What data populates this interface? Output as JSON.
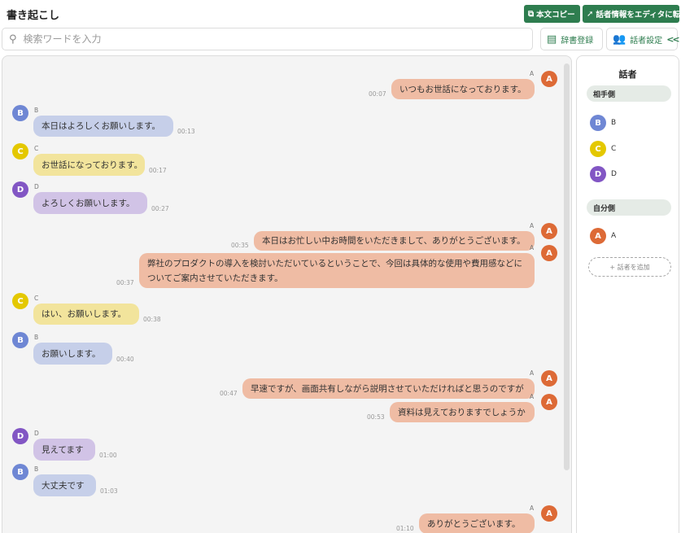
{
  "app": {
    "title": "書き起こし"
  },
  "toolbar": {
    "copy_label": "本文コピー",
    "reflect_label": "話者情報をエディタに転記",
    "search_placeholder": "検索ワードを入力",
    "dict_label": "辞書登録",
    "speaker_settings_label": "話者設定",
    "collapse_label": "<<"
  },
  "messages": [
    {
      "speaker": "A",
      "text": "いつもお世話になっております。",
      "time": "00:07"
    },
    {
      "speaker": "B",
      "text": "本日はよろしくお願いします。",
      "time": "00:13"
    },
    {
      "speaker": "C",
      "text": "お世話になっております。",
      "time": "00:17"
    },
    {
      "speaker": "D",
      "text": "よろしくお願いします。",
      "time": "00:27"
    },
    {
      "speaker": "A",
      "text": "本日はお忙しい中お時間をいただきまして、ありがとうございます。",
      "time": "00:35"
    },
    {
      "speaker": "A",
      "text": "弊社のプロダクトの導入を検討いただいているということで、今回は具体的な使用や費用感などについてご案内させていただきます。",
      "time": "00:37"
    },
    {
      "speaker": "C",
      "text": "はい、お願いします。",
      "time": "00:38"
    },
    {
      "speaker": "B",
      "text": "お願いします。",
      "time": "00:40"
    },
    {
      "speaker": "A",
      "text": "早速ですが、画面共有しながら説明させていただければと思うのですが",
      "time": "00:47"
    },
    {
      "speaker": "A",
      "text": "資料は見えておりますでしょうか",
      "time": "00:53"
    },
    {
      "speaker": "D",
      "text": "見えてます",
      "time": "01:00"
    },
    {
      "speaker": "B",
      "text": "大丈夫です",
      "time": "01:03"
    },
    {
      "speaker": "A",
      "text": "ありがとうございます。",
      "time": "01:10"
    }
  ],
  "panel": {
    "title": "話者",
    "group_other": "相手側",
    "group_self": "自分側",
    "others": [
      {
        "letter": "B",
        "name": "B"
      },
      {
        "letter": "C",
        "name": "C"
      },
      {
        "letter": "D",
        "name": "D"
      }
    ],
    "self": [
      {
        "letter": "A",
        "name": "A"
      }
    ],
    "add_label": "+ 話者を追加"
  },
  "colors": {
    "brand_green": "#2e7d4f",
    "speaker_A": "#dd6a36",
    "speaker_B": "#6f87d4",
    "speaker_C": "#e4c800",
    "speaker_D": "#8256c4"
  }
}
